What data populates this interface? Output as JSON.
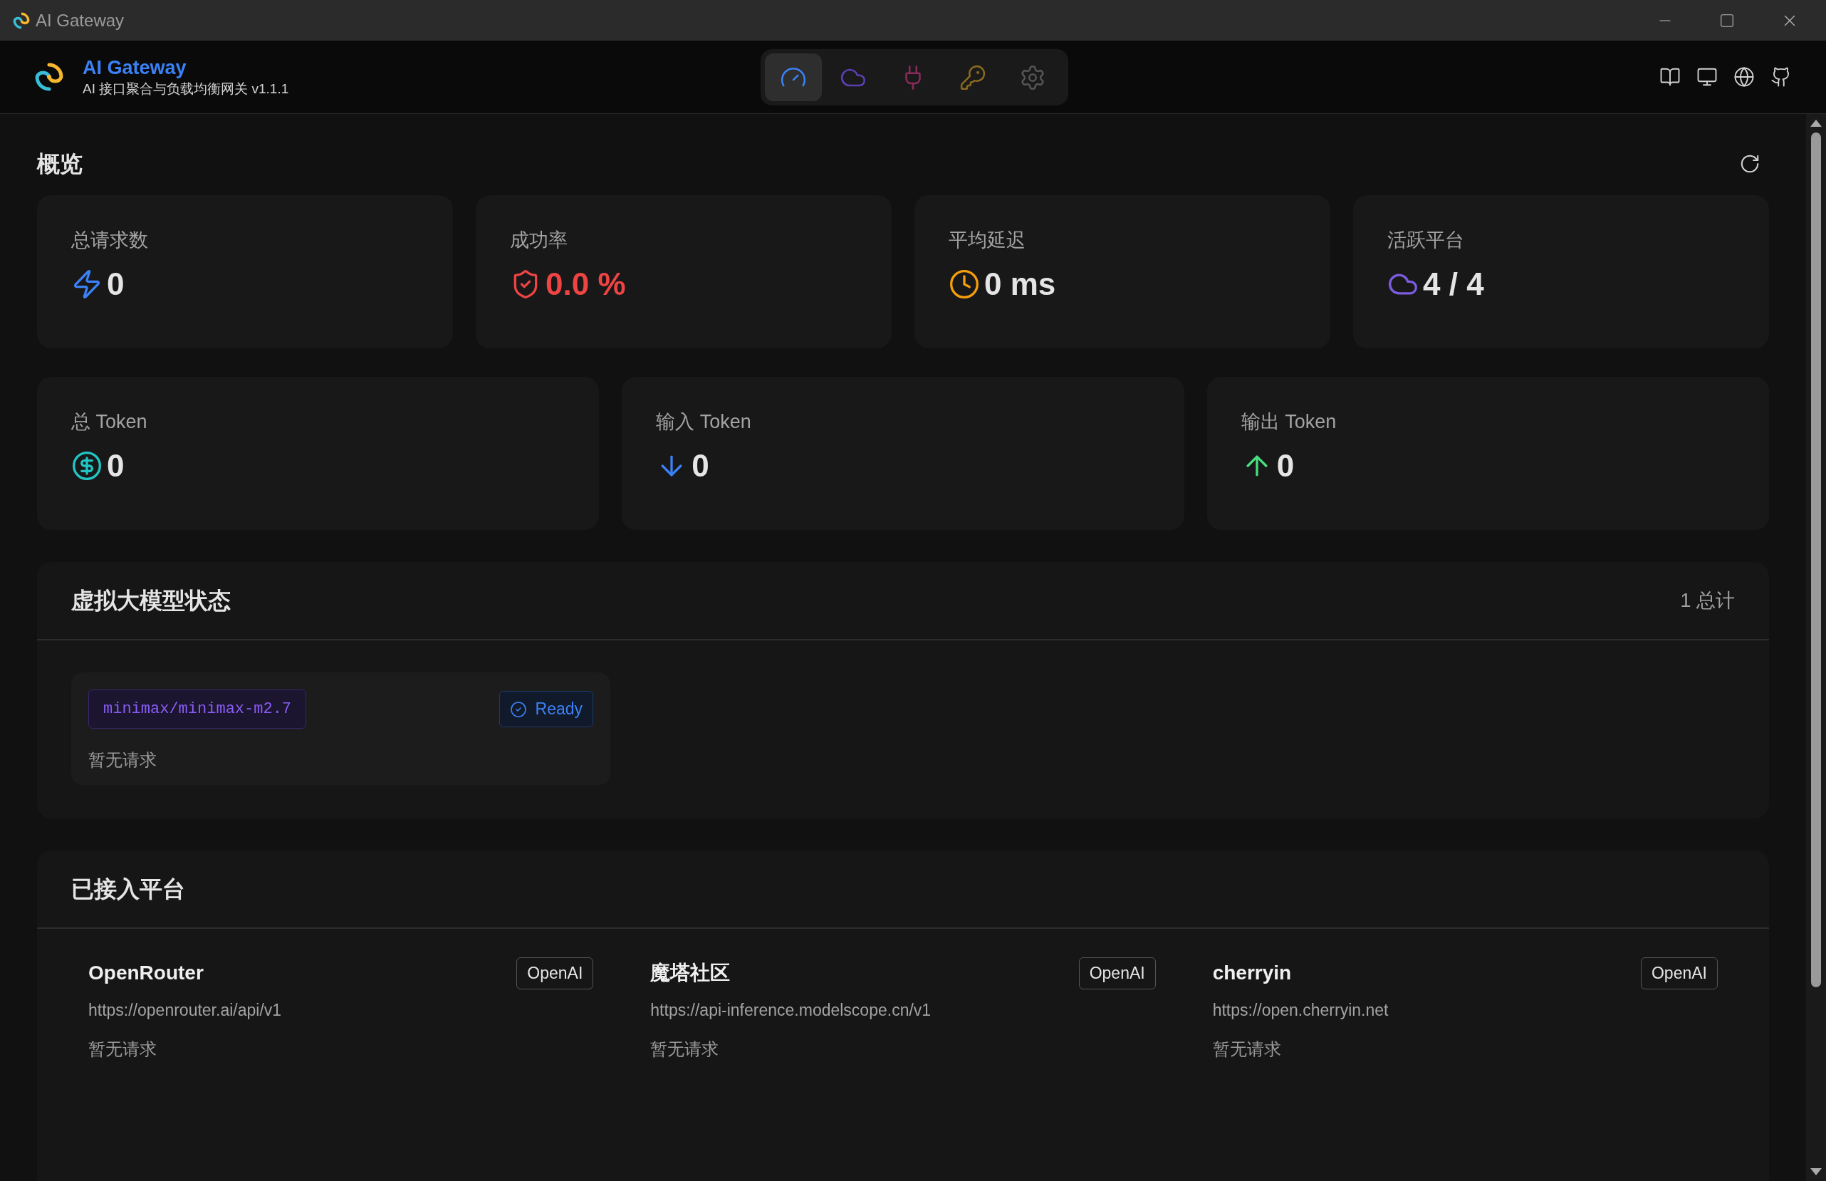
{
  "window": {
    "title": "AI Gateway"
  },
  "header": {
    "title": "AI Gateway",
    "subtitle": "AI 接口聚合与负载均衡网关 v1.1.1"
  },
  "nav_tabs": [
    {
      "kind": "dashboard",
      "selected": true
    },
    {
      "kind": "cloud",
      "selected": false
    },
    {
      "kind": "plug",
      "selected": false
    },
    {
      "kind": "key",
      "selected": false
    },
    {
      "kind": "settings",
      "selected": false
    }
  ],
  "overview": {
    "title": "概览",
    "stats": [
      {
        "kind": "requests",
        "label": "总请求数",
        "value": "0"
      },
      {
        "kind": "success",
        "label": "成功率",
        "value": "0.0 %"
      },
      {
        "kind": "latency",
        "label": "平均延迟",
        "value": "0 ms"
      },
      {
        "kind": "platforms",
        "label": "活跃平台",
        "value": "4 / 4"
      }
    ],
    "token_stats": [
      {
        "kind": "total",
        "label": "总 Token",
        "value": "0"
      },
      {
        "kind": "input",
        "label": "输入 Token",
        "value": "0"
      },
      {
        "kind": "output",
        "label": "输出 Token",
        "value": "0"
      }
    ]
  },
  "virtual_models": {
    "title": "虚拟大模型状态",
    "count": "1 总计",
    "items": [
      {
        "name": "minimax/minimax-m2.7",
        "status": "Ready",
        "note": "暂无请求"
      }
    ]
  },
  "platforms": {
    "title": "已接入平台",
    "items": [
      {
        "name": "OpenRouter",
        "type": "OpenAI",
        "url": "https://openrouter.ai/api/v1",
        "note": "暂无请求"
      },
      {
        "name": "魔塔社区",
        "type": "OpenAI",
        "url": "https://api-inference.modelscope.cn/v1",
        "note": "暂无请求"
      },
      {
        "name": "cherryin",
        "type": "OpenAI",
        "url": "https://open.cherryin.net",
        "note": "暂无请求"
      }
    ]
  }
}
